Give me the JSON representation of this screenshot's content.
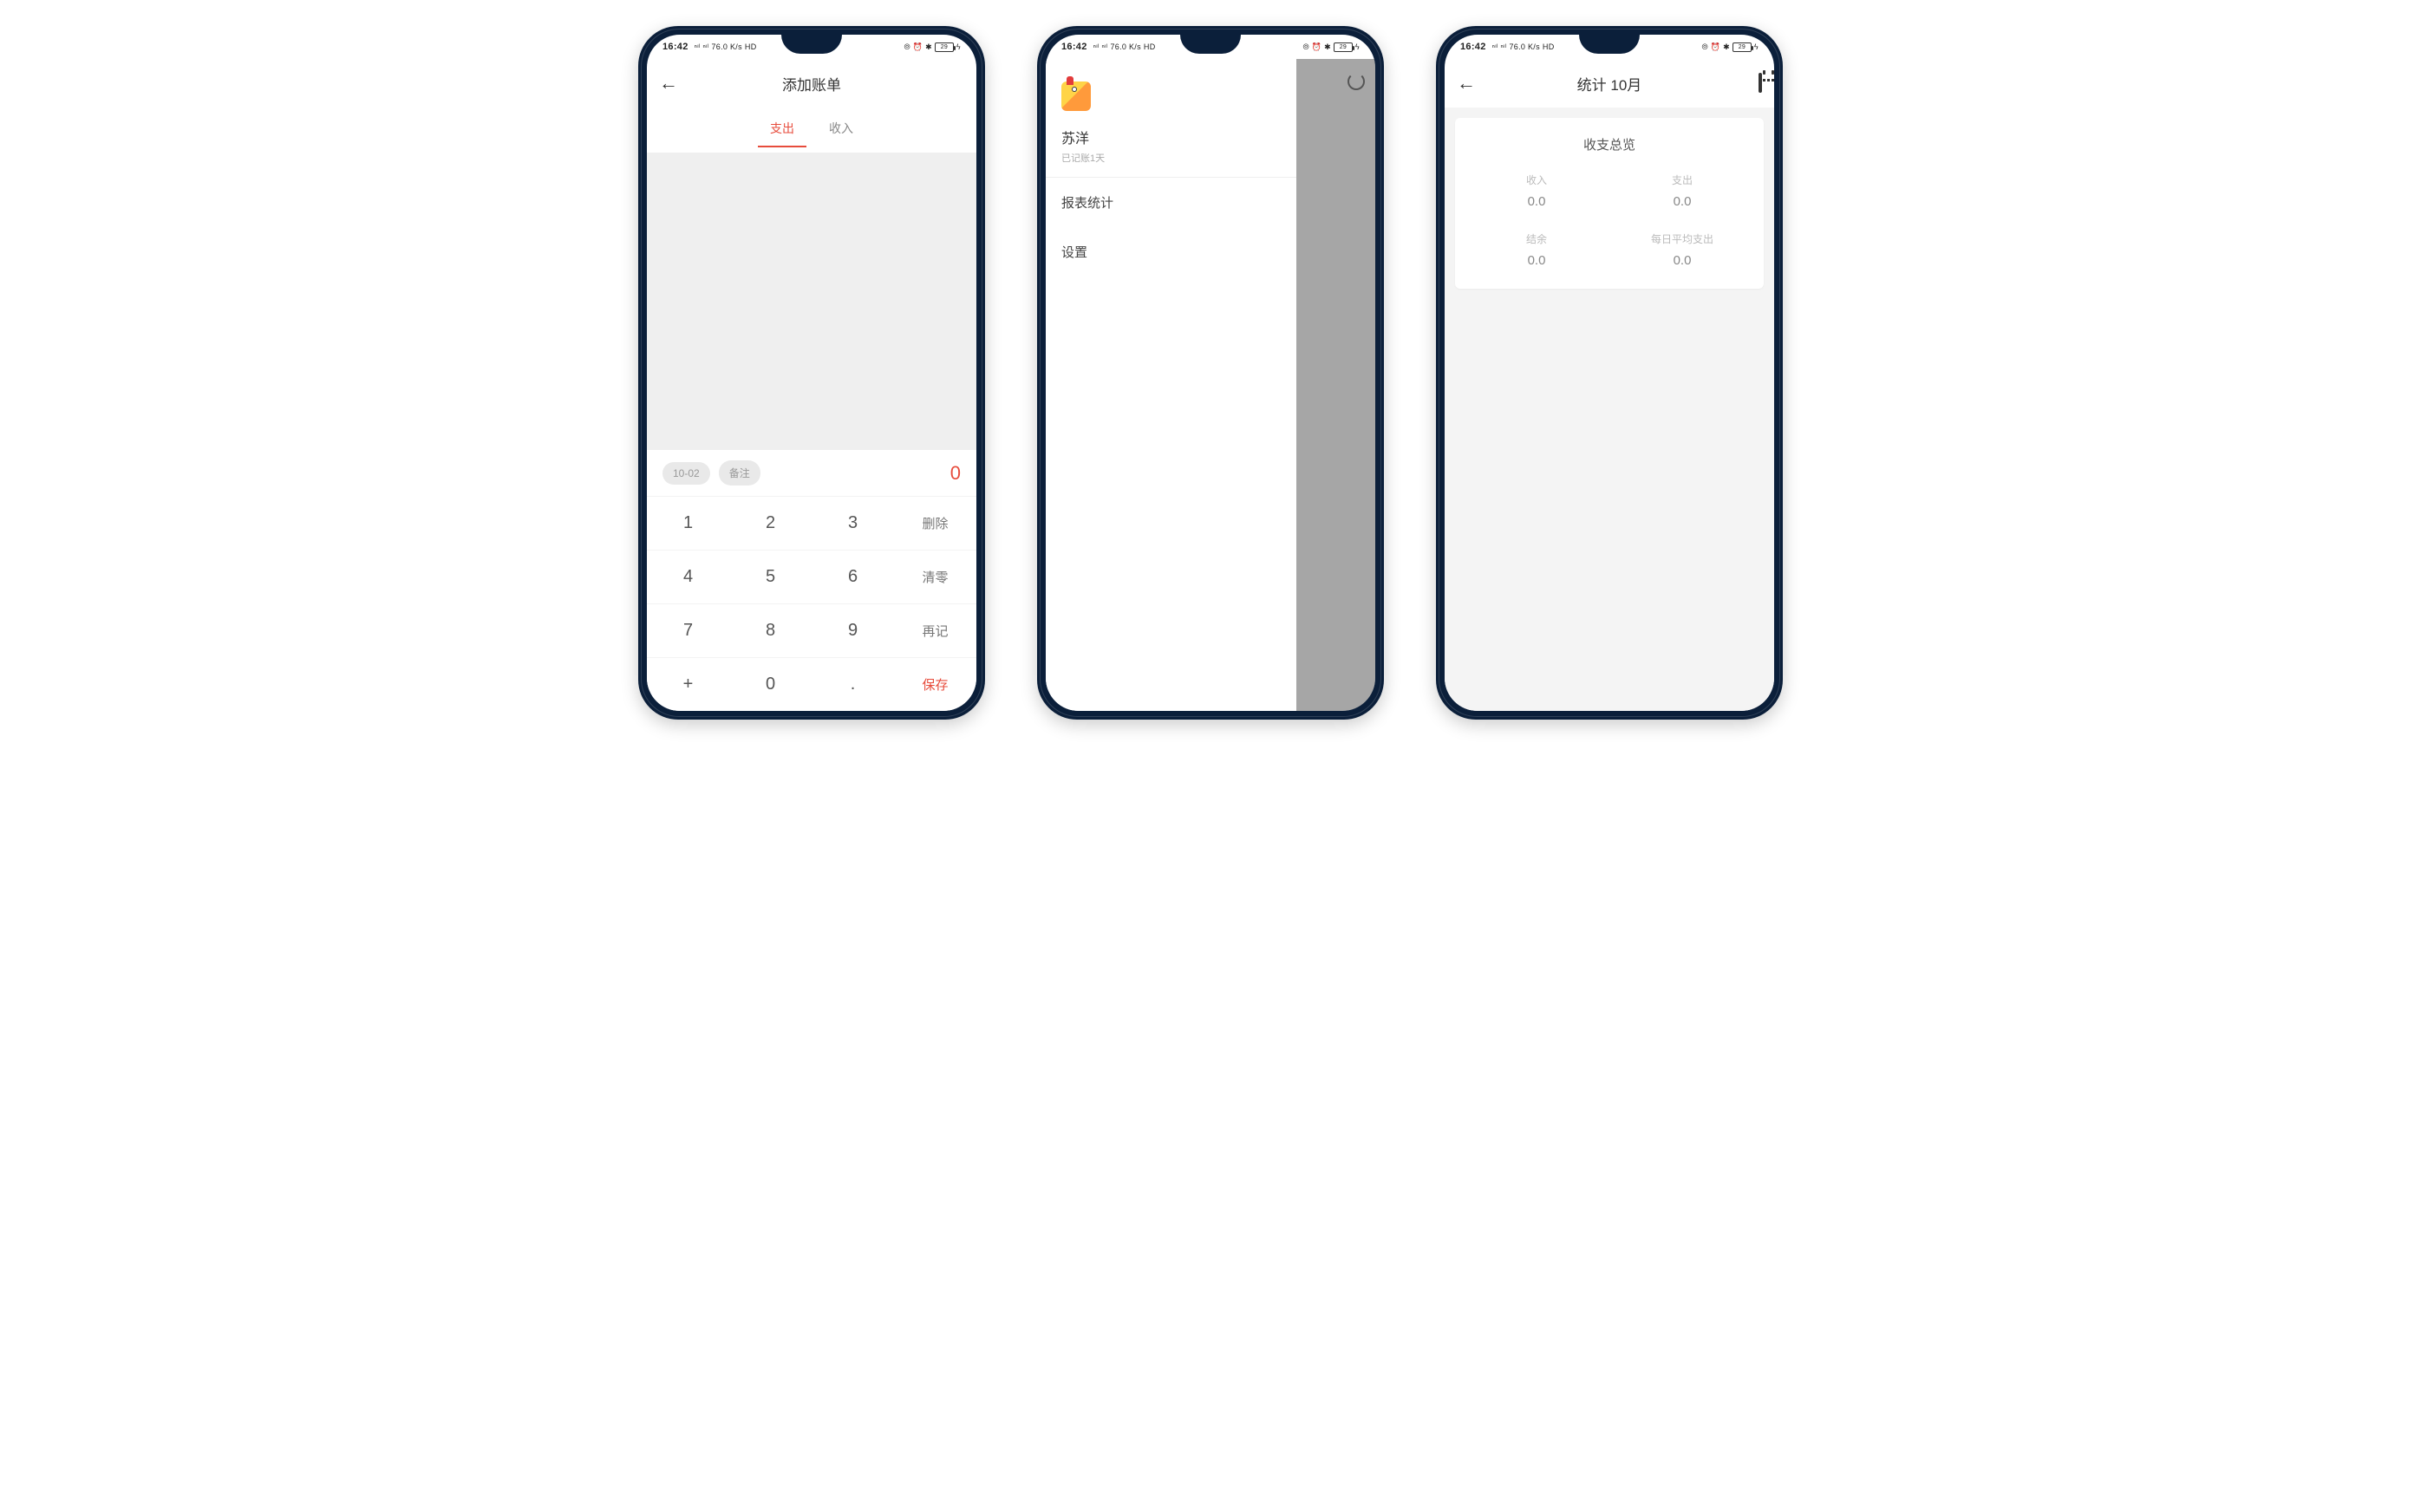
{
  "statusbar": {
    "time": "16:42",
    "sig_text": "ⁿᶦˡ ⁿᶦˡ",
    "net": "76.0 K/s",
    "hd": "HD",
    "battery": "29",
    "icons": "⦾ ⏰ ✱"
  },
  "screen1": {
    "title": "添加账单",
    "tab_expense": "支出",
    "tab_income": "收入",
    "chip_date": "10-02",
    "chip_note": "备注",
    "amount": "0",
    "keys": {
      "k1": "1",
      "k2": "2",
      "k3": "3",
      "del": "删除",
      "k4": "4",
      "k5": "5",
      "k6": "6",
      "clr": "清零",
      "k7": "7",
      "k8": "8",
      "k9": "9",
      "again": "再记",
      "plus": "+",
      "k0": "0",
      "dot": ".",
      "save": "保存"
    }
  },
  "screen2": {
    "username": "苏洋",
    "subtitle": "已记账1天",
    "menu_reports": "报表统计",
    "menu_settings": "设置"
  },
  "screen3": {
    "title": "统计 10月",
    "card_title": "收支总览",
    "stats": {
      "income_label": "收入",
      "income_val": "0.0",
      "expense_label": "支出",
      "expense_val": "0.0",
      "balance_label": "结余",
      "balance_val": "0.0",
      "avg_label": "每日平均支出",
      "avg_val": "0.0"
    }
  }
}
